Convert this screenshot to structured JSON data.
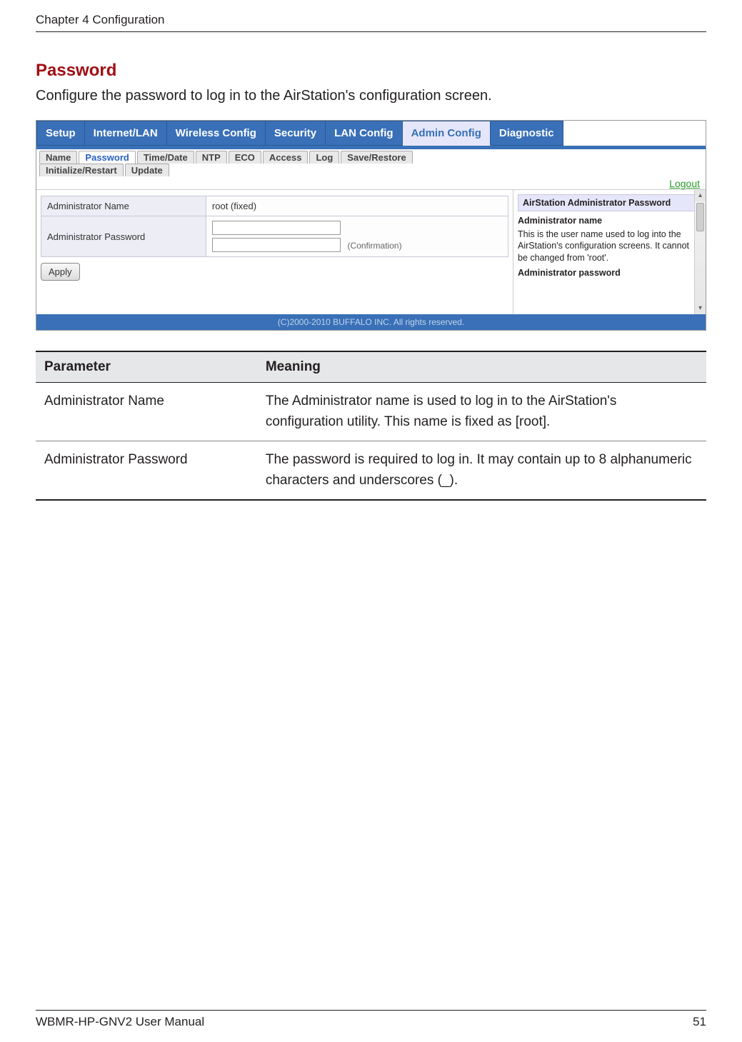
{
  "header": {
    "chapter": "Chapter 4  Configuration"
  },
  "section": {
    "title": "Password",
    "intro": "Configure the password to log in to the AirStation's configuration screen."
  },
  "screenshot": {
    "main_tabs": [
      "Setup",
      "Internet/LAN",
      "Wireless Config",
      "Security",
      "LAN Config",
      "Admin Config",
      "Diagnostic"
    ],
    "main_tabs_active_index": 5,
    "sub_tabs_row1": [
      "Name",
      "Password",
      "Time/Date",
      "NTP",
      "ECO",
      "Access",
      "Log",
      "Save/Restore"
    ],
    "sub_tabs_row2": [
      "Initialize/Restart",
      "Update"
    ],
    "sub_tabs_active_index": 1,
    "logout": "Logout",
    "fields": {
      "admin_name_label": "Administrator Name",
      "admin_name_value": "root (fixed)",
      "admin_pass_label": "Administrator Password",
      "confirmation_label": "(Confirmation)"
    },
    "apply_label": "Apply",
    "help": {
      "title": "AirStation Administrator Password",
      "sub1": "Administrator name",
      "text1": "This is the user name used to log into the AirStation's configuration screens. It cannot be changed from 'root'.",
      "sub2": "Administrator password"
    },
    "footer": "(C)2000-2010 BUFFALO INC. All rights reserved."
  },
  "table": {
    "head_parameter": "Parameter",
    "head_meaning": "Meaning",
    "rows": [
      {
        "param": "Administrator Name",
        "meaning": "The Administrator name is used to log in to the AirStation's configuration utility. This name is fixed as [root]."
      },
      {
        "param": "Administrator Password",
        "meaning": "The password is required to log in.  It may contain up to 8 alphanumeric characters and underscores (_)."
      }
    ]
  },
  "footer": {
    "manual": "WBMR-HP-GNV2 User Manual",
    "page": "51"
  }
}
